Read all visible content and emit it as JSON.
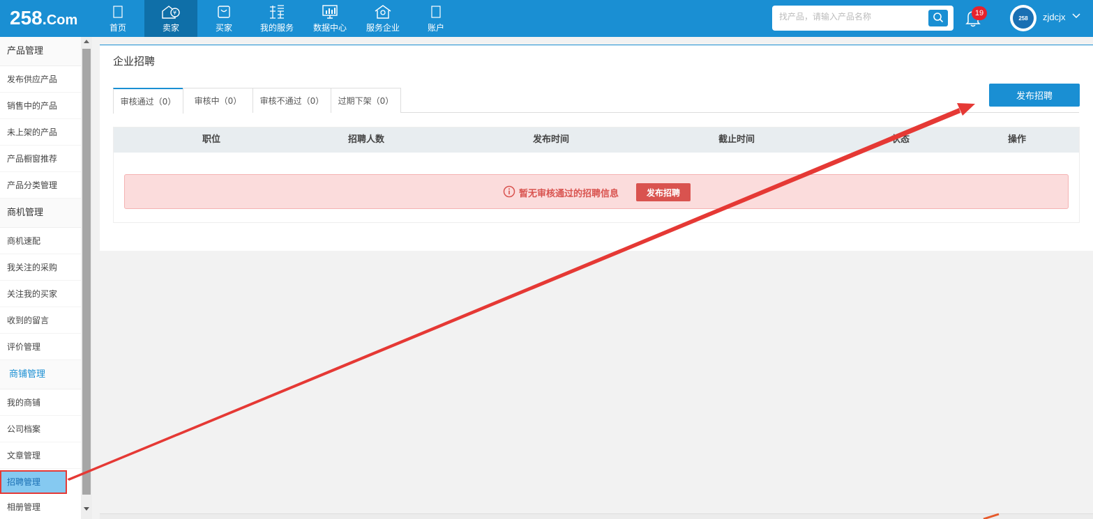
{
  "logo": {
    "main": "258",
    "dot": ".",
    "suffix": "Com"
  },
  "nav": [
    {
      "label": "首页",
      "icon": "home-icon",
      "active": false
    },
    {
      "label": "卖家",
      "icon": "seller-icon",
      "active": true
    },
    {
      "label": "买家",
      "icon": "shopping-bag-icon",
      "active": false
    },
    {
      "label": "我的服务",
      "icon": "service-icon",
      "active": false
    },
    {
      "label": "数据中心",
      "icon": "data-center-icon",
      "active": false
    },
    {
      "label": "服务企业",
      "icon": "enterprise-icon",
      "active": false
    },
    {
      "label": "账户",
      "icon": "account-icon",
      "active": false
    }
  ],
  "search": {
    "placeholder": "找产品，请输入产品名称"
  },
  "notifications": {
    "count": "19"
  },
  "user": {
    "avatar_text": "258",
    "name": "zjdcjx"
  },
  "sidebar": {
    "groups": [
      {
        "title": "产品管理",
        "active": false,
        "items": [
          "发布供应产品",
          "销售中的产品",
          "未上架的产品",
          "产品橱窗推荐",
          "产品分类管理"
        ]
      },
      {
        "title": "商机管理",
        "active": false,
        "items": [
          "商机速配",
          "我关注的采购",
          "关注我的买家",
          "收到的留言",
          "评价管理"
        ]
      },
      {
        "title": "商铺管理",
        "active": true,
        "items": [
          "我的商铺",
          "公司档案",
          "文章管理",
          "招聘管理",
          "相册管理"
        ]
      }
    ],
    "selected_item": "招聘管理"
  },
  "main": {
    "title": "企业招聘",
    "tabs": [
      {
        "label": "审核通过（0）",
        "active": true
      },
      {
        "label": "审核中（0）",
        "active": false
      },
      {
        "label": "审核不通过（0）",
        "active": false
      },
      {
        "label": "过期下架（0）",
        "active": false
      }
    ],
    "publish_button": "发布招聘",
    "table": {
      "columns": [
        "职位",
        "招聘人数",
        "发布时间",
        "截止时间",
        "状态",
        "操作"
      ]
    },
    "empty_alert": {
      "message": "暂无审核通过的招聘信息",
      "button": "发布招聘"
    }
  },
  "colors": {
    "primary": "#1a8fd3",
    "nav_active": "#0f6fa8",
    "alert_bg": "#fbdcdc",
    "alert_text": "#d9534f",
    "annotation": "#e53935"
  }
}
